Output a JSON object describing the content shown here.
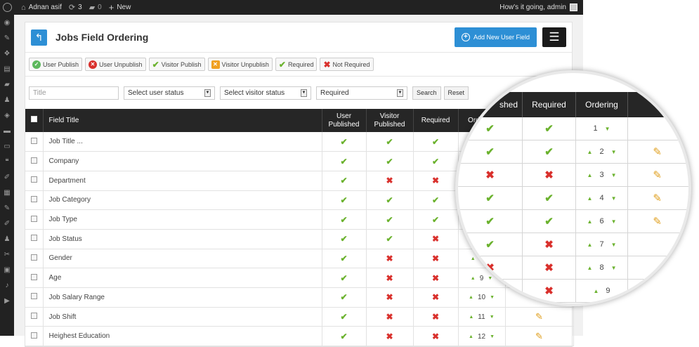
{
  "admin_bar": {
    "site_name": "Adnan asif",
    "updates_count": "3",
    "comments_count": "0",
    "new_label": "New",
    "greeting": "How's it going, admin"
  },
  "header": {
    "title": "Jobs Field Ordering",
    "add_button": "Add New User Field"
  },
  "legend": {
    "user_publish": "User Publish",
    "user_unpublish": "User Unpublish",
    "visitor_publish": "Visitor Publish",
    "visitor_unpublish": "Visitor Unpublish",
    "required": "Required",
    "not_required": "Not Required"
  },
  "filters": {
    "title_placeholder": "Title",
    "user_status": "Select user status",
    "visitor_status": "Select visitor status",
    "required": "Required",
    "search": "Search",
    "reset": "Reset"
  },
  "table": {
    "headers": {
      "field_title": "Field Title",
      "user_published_1": "User",
      "user_published_2": "Published",
      "visitor_published_1": "Visitor",
      "visitor_published_2": "Published",
      "required": "Required",
      "ordering": "Ordering"
    },
    "rows": [
      {
        "title": "Job Title ...",
        "user": true,
        "visitor": true,
        "required": true,
        "order": "1"
      },
      {
        "title": "Company",
        "user": true,
        "visitor": true,
        "required": true,
        "order": "2"
      },
      {
        "title": "Department",
        "user": true,
        "visitor": false,
        "required": false,
        "order": "3"
      },
      {
        "title": "Job Category",
        "user": true,
        "visitor": true,
        "required": true,
        "order": "4"
      },
      {
        "title": "Job Type",
        "user": true,
        "visitor": true,
        "required": true,
        "order": "6"
      },
      {
        "title": "Job Status",
        "user": true,
        "visitor": true,
        "required": false,
        "order": "7"
      },
      {
        "title": "Gender",
        "user": true,
        "visitor": false,
        "required": false,
        "order": "8"
      },
      {
        "title": "Age",
        "user": true,
        "visitor": false,
        "required": false,
        "order": "9"
      },
      {
        "title": "Job Salary Range",
        "user": true,
        "visitor": false,
        "required": false,
        "order": "10"
      },
      {
        "title": "Job Shift",
        "user": true,
        "visitor": false,
        "required": false,
        "order": "11"
      },
      {
        "title": "Heighest Education",
        "user": true,
        "visitor": false,
        "required": false,
        "order": "12"
      }
    ]
  },
  "zoom": {
    "headers": {
      "published_fragment": "shed",
      "required": "Required",
      "ordering": "Ordering"
    },
    "rows": [
      {
        "visitor": true,
        "required": true,
        "order": "1"
      },
      {
        "visitor": true,
        "required": true,
        "order": "2"
      },
      {
        "visitor": false,
        "required": false,
        "order": "3"
      },
      {
        "visitor": true,
        "required": true,
        "order": "4"
      },
      {
        "visitor": true,
        "required": true,
        "order": "6"
      },
      {
        "visitor": true,
        "required": false,
        "order": "7"
      },
      {
        "visitor": false,
        "required": false,
        "order": "8"
      },
      {
        "visitor": null,
        "required": false,
        "order": "9"
      }
    ]
  },
  "colors": {
    "accent": "#2d8fd5",
    "check": "#6bb22e",
    "cross": "#d9302c",
    "header_bg": "#262626"
  }
}
